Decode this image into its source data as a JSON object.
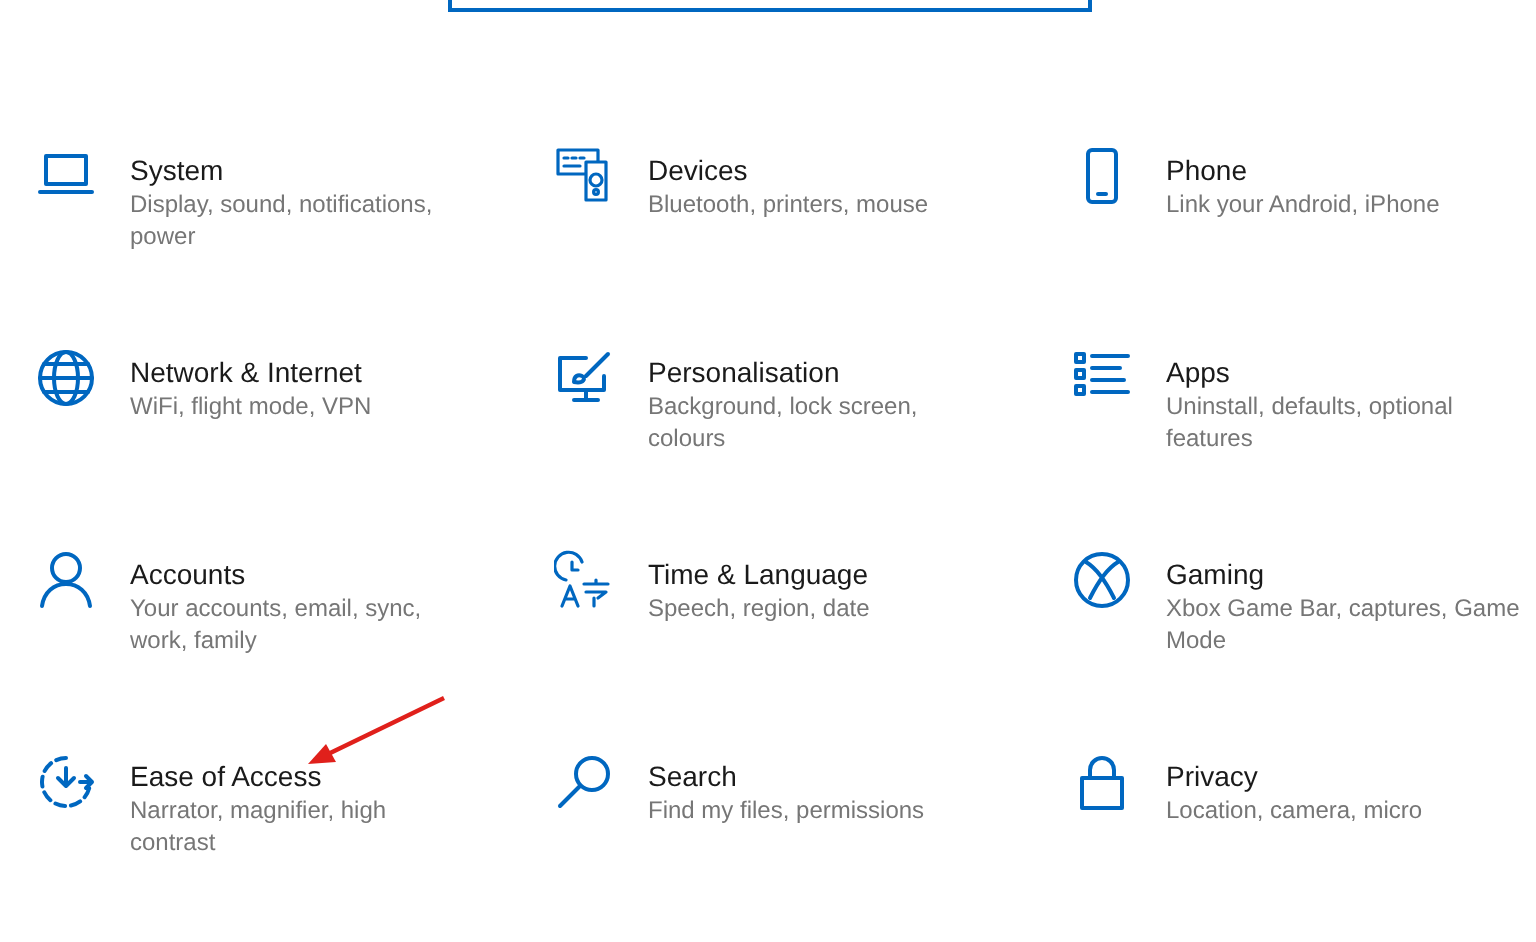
{
  "categories": [
    {
      "title": "System",
      "description": "Display, sound, notifications, power"
    },
    {
      "title": "Devices",
      "description": "Bluetooth, printers, mouse"
    },
    {
      "title": "Phone",
      "description": "Link your Android, iPhone"
    },
    {
      "title": "Network & Internet",
      "description": "WiFi, flight mode, VPN"
    },
    {
      "title": "Personalisation",
      "description": "Background, lock screen, colours"
    },
    {
      "title": "Apps",
      "description": "Uninstall, defaults, optional features"
    },
    {
      "title": "Accounts",
      "description": "Your accounts, email, sync, work, family"
    },
    {
      "title": "Time & Language",
      "description": "Speech, region, date"
    },
    {
      "title": "Gaming",
      "description": "Xbox Game Bar, captures, Game Mode"
    },
    {
      "title": "Ease of Access",
      "description": "Narrator, magnifier, high contrast"
    },
    {
      "title": "Search",
      "description": "Find my files, permissions"
    },
    {
      "title": "Privacy",
      "description": "Location, camera, micro"
    }
  ]
}
